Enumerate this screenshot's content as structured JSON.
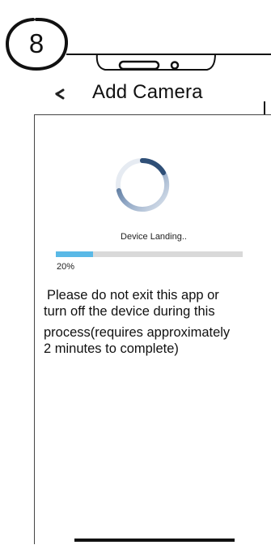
{
  "step": {
    "number": "8"
  },
  "header": {
    "back_icon": "back-arrow-icon",
    "title": "Add Camera"
  },
  "loading": {
    "spinner_icon": "loading-spinner-icon",
    "status": "Device  Landing..",
    "progress_fraction": 0.2,
    "progress_label": "20%",
    "accent_color": "#5ab9e6"
  },
  "instructions": {
    "line1": "Please do not exit this app or",
    "line2": "turn off the device during  this",
    "line3": "process(requires approximately",
    "line4": "2 minutes to complete)"
  }
}
